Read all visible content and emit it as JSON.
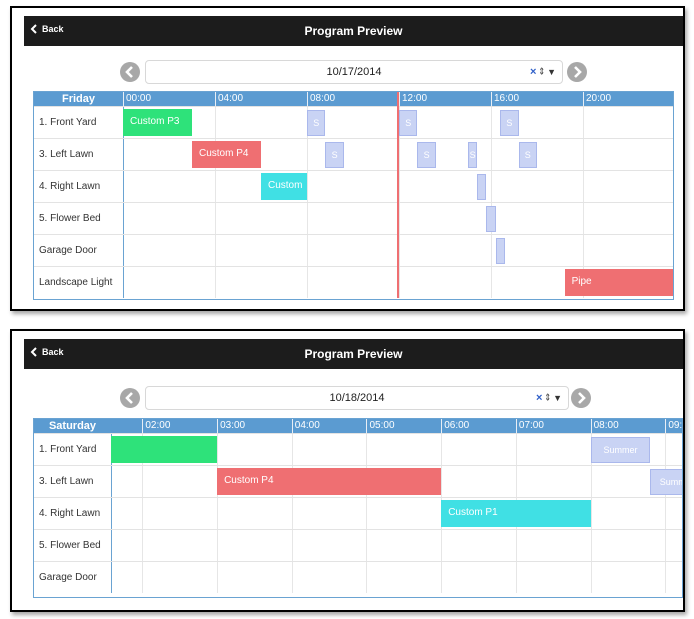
{
  "colors": {
    "header_bg": "#1c1c1c",
    "grid_header": "#5b9bd1",
    "green": "#2ee27a",
    "red": "#ef6f72",
    "cyan": "#40e0e4",
    "summer": "#c9d3f4"
  },
  "panels": [
    {
      "back_label": "Back",
      "title": "Program Preview",
      "date_value": "10/17/2014",
      "clear_symbol": "×",
      "spin_symbol": "⇕",
      "caret_symbol": "▼",
      "day_label": "Friday",
      "ticks": [
        "00:00",
        "04:00",
        "08:00",
        "12:00",
        "16:00",
        "20:00"
      ],
      "rows": [
        "1. Front Yard",
        "3. Left Lawn",
        "4. Right Lawn",
        "5. Flower Bed",
        "Garage Door",
        "Landscape Light"
      ],
      "events": [
        {
          "label": "Custom P3",
          "row": 0,
          "start": 0,
          "end": 3
        },
        {
          "label": "Custom P4",
          "row": 1,
          "start": 3,
          "end": 6
        },
        {
          "label": "Custom",
          "row": 2,
          "start": 6,
          "end": 8
        },
        {
          "label": "Pipe",
          "row": 5,
          "start": 19.2,
          "end": 24
        },
        {
          "label": "S",
          "row": 0,
          "start": 8.0,
          "end": 8.8
        },
        {
          "label": "S",
          "row": 0,
          "start": 12.0,
          "end": 12.8
        },
        {
          "label": "S",
          "row": 0,
          "start": 16.4,
          "end": 17.2
        },
        {
          "label": "S",
          "row": 1,
          "start": 8.8,
          "end": 9.6
        },
        {
          "label": "S",
          "row": 1,
          "start": 12.8,
          "end": 13.6
        },
        {
          "label": "S",
          "row": 1,
          "start": 15.0,
          "end": 15.4
        },
        {
          "label": "S",
          "row": 1,
          "start": 17.2,
          "end": 18.0
        },
        {
          "label": "",
          "row": 2,
          "start": 15.4,
          "end": 15.8
        },
        {
          "label": "",
          "row": 3,
          "start": 15.8,
          "end": 16.2
        },
        {
          "label": "",
          "row": 4,
          "start": 16.2,
          "end": 16.6
        }
      ],
      "now_hour": 11.9
    },
    {
      "back_label": "Back",
      "title": "Program Preview",
      "date_value": "10/18/2014",
      "clear_symbol": "×",
      "spin_symbol": "⇕",
      "caret_symbol": "▼",
      "day_label": "Saturday",
      "ticks": [
        "02:00",
        "03:00",
        "04:00",
        "05:00",
        "06:00",
        "07:00",
        "08:00",
        "09:0"
      ],
      "rows": [
        "1. Front Yard",
        "3. Left Lawn",
        "4. Right Lawn",
        "5. Flower Bed",
        "Garage Door"
      ],
      "events": [
        {
          "label": "",
          "row": 0,
          "start": 1.58,
          "end": 3.0
        },
        {
          "label": "Custom P4",
          "row": 1,
          "start": 3.0,
          "end": 6.0
        },
        {
          "label": "Custom P1",
          "row": 2,
          "start": 6.0,
          "end": 8.0
        },
        {
          "label": "Summer",
          "row": 0,
          "start": 8.0,
          "end": 8.8
        },
        {
          "label": "Summ",
          "row": 1,
          "start": 8.8,
          "end": 9.4
        }
      ]
    }
  ]
}
